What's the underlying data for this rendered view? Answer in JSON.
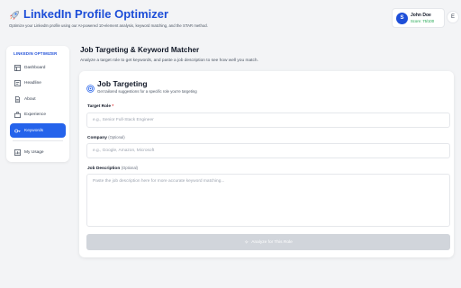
{
  "header": {
    "title": "LinkedIn Profile Optimizer",
    "subtitle": "Optimize your LinkedIn profile using our AI-powered 10-element analysis, keyword matching, and the STAR method.",
    "rocket_icon": "rocket-icon"
  },
  "user": {
    "initial": "S",
    "name": "John Doe",
    "score": "Score: 75/100",
    "settings_label": "E",
    "accent": "#1d4ed8",
    "score_color": "#16a34a"
  },
  "sidebar": {
    "heading": "LINKEDIN OPTIMIZER",
    "items": [
      {
        "label": "Dashboard",
        "icon": "dashboard-icon",
        "active": false
      },
      {
        "label": "Headline",
        "icon": "headline-icon",
        "active": false
      },
      {
        "label": "About",
        "icon": "about-icon",
        "active": false
      },
      {
        "label": "Experience",
        "icon": "briefcase-icon",
        "active": false
      },
      {
        "label": "Keywords",
        "icon": "key-icon",
        "active": true
      }
    ],
    "usage": {
      "label": "My Usage",
      "icon": "usage-icon"
    }
  },
  "main": {
    "title": "Job Targeting & Keyword Matcher",
    "description": "Analyze a target role to get keywords, and paste a job description to see how well you match."
  },
  "card": {
    "title": "Job Targeting",
    "subtitle": "Get tailored suggestions for a specific role you're targeting",
    "target_role": {
      "label": "Target Role",
      "required_mark": "*",
      "placeholder": "e.g., Senior Full-Stack Engineer"
    },
    "company": {
      "label": "Company",
      "optional": "(Optional)",
      "placeholder": "e.g., Google, Amazon, Microsoft"
    },
    "job_description": {
      "label": "Job Description",
      "optional": "(Optional)",
      "placeholder": "Paste the job description here for more accurate keyword matching..."
    },
    "submit_label": "Analyze for This Role"
  },
  "colors": {
    "brand": "#1d4ed8",
    "active_nav": "#2563eb",
    "disabled_button": "#d1d5db",
    "background": "#f3f4f6"
  }
}
